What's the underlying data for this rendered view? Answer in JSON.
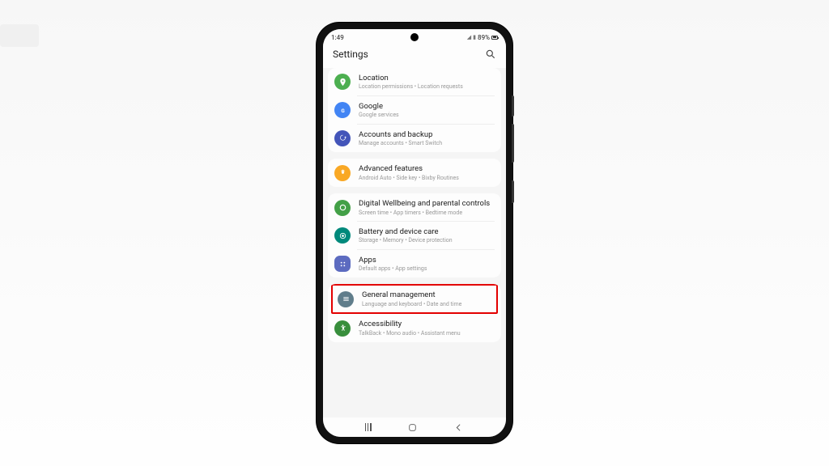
{
  "status_bar": {
    "time": "1:49",
    "battery_text": "89%"
  },
  "header": {
    "title": "Settings"
  },
  "groups": [
    {
      "items": [
        {
          "id": "location",
          "title": "Location",
          "sub": "Location permissions • Location requests",
          "icon": "location-icon",
          "color": "#4caf50"
        },
        {
          "id": "google",
          "title": "Google",
          "sub": "Google services",
          "icon": "google-icon",
          "color": "#4285f4"
        },
        {
          "id": "accounts",
          "title": "Accounts and backup",
          "sub": "Manage accounts • Smart Switch",
          "icon": "backup-icon",
          "color": "#4355b9"
        }
      ]
    },
    {
      "items": [
        {
          "id": "advanced",
          "title": "Advanced features",
          "sub": "Android Auto • Side key • Bixby Routines",
          "icon": "advanced-icon",
          "color": "#f9a825"
        }
      ]
    },
    {
      "items": [
        {
          "id": "wellbeing",
          "title": "Digital Wellbeing and parental controls",
          "sub": "Screen time • App timers • Bedtime mode",
          "icon": "wellbeing-icon",
          "color": "#43a047"
        },
        {
          "id": "battery",
          "title": "Battery and device care",
          "sub": "Storage • Memory • Device protection",
          "icon": "battery-icon",
          "color": "#00897b"
        },
        {
          "id": "apps",
          "title": "Apps",
          "sub": "Default apps • App settings",
          "icon": "apps-icon",
          "color": "#5c6bc0",
          "rounded": true
        }
      ]
    },
    {
      "items": [
        {
          "id": "general",
          "title": "General management",
          "sub": "Language and keyboard • Date and time",
          "icon": "general-icon",
          "color": "#607d8b",
          "highlighted": true
        },
        {
          "id": "accessibility",
          "title": "Accessibility",
          "sub": "TalkBack • Mono audio • Assistant menu",
          "icon": "accessibility-icon",
          "color": "#388e3c"
        }
      ]
    }
  ]
}
